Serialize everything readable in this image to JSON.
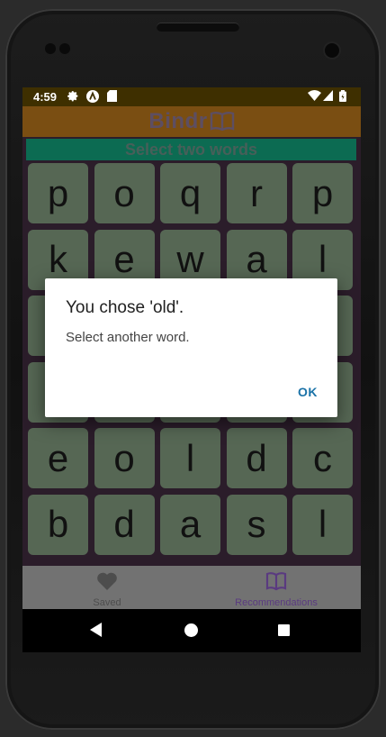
{
  "status_bar": {
    "time": "4:59",
    "left_icons": [
      "gear-icon",
      "a-circle-icon",
      "sd-card-icon"
    ],
    "right_icons": [
      "wifi-icon",
      "signal-icon",
      "battery-icon"
    ]
  },
  "app_bar": {
    "title": "Bindr",
    "logo": "book-icon"
  },
  "prompt": "Select two words",
  "letter_grid": [
    [
      "p",
      "o",
      "q",
      "r",
      "p"
    ],
    [
      "k",
      "e",
      "w",
      "a",
      "l"
    ],
    [
      "",
      "",
      "",
      "",
      ""
    ],
    [
      "",
      "",
      "",
      "",
      ""
    ],
    [
      "e",
      "o",
      "l",
      "d",
      "c"
    ],
    [
      "b",
      "d",
      "a",
      "s",
      "l"
    ]
  ],
  "bottom_nav": {
    "items": [
      {
        "label": "Saved",
        "icon": "heart-icon",
        "active": false
      },
      {
        "label": "Recommendations",
        "icon": "book-icon",
        "active": true
      }
    ]
  },
  "dialog": {
    "title": "You chose 'old'.",
    "message": "Select another word.",
    "ok_label": "OK"
  },
  "colors": {
    "accent": "#1b73a8",
    "active_nav": "#5a3a80",
    "tile": "#566754",
    "prompt_bg": "#0c6b52"
  }
}
